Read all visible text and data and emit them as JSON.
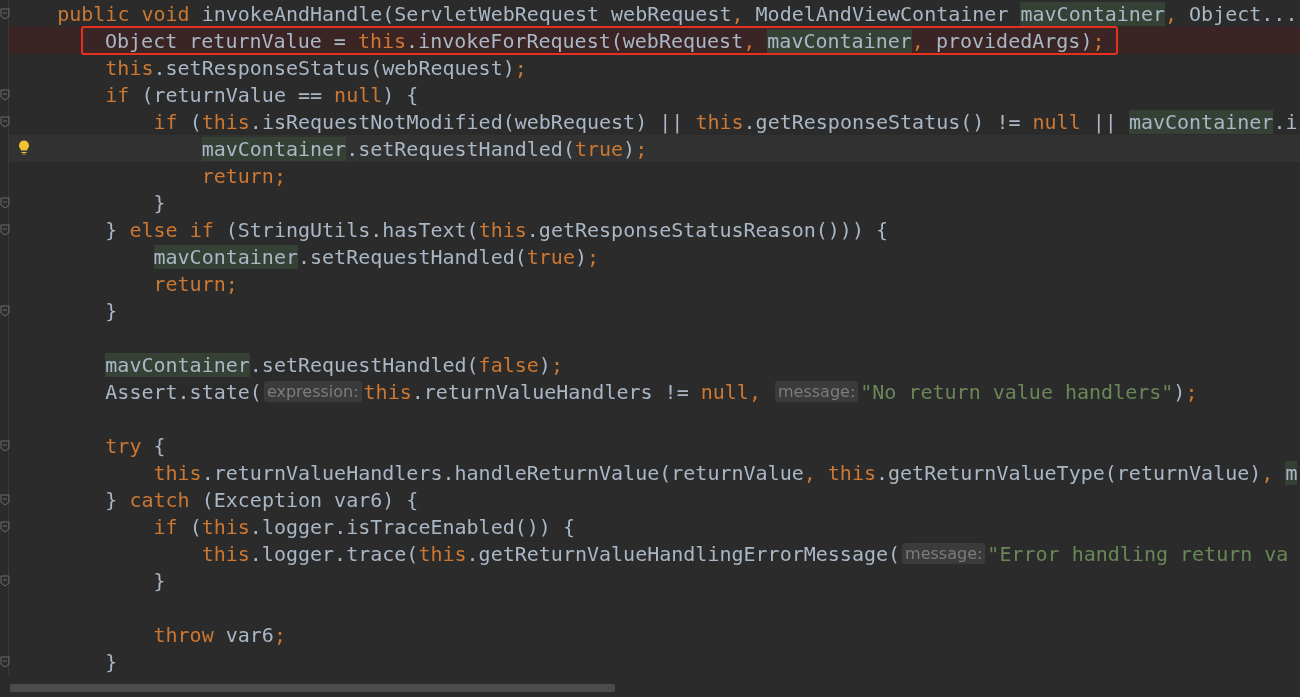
{
  "editor": {
    "lines": [
      {
        "kind": "code",
        "fold": true,
        "tokens": [
          {
            "kind": "keyword",
            "text": "    public void "
          },
          {
            "kind": "plain",
            "text": "invokeAndHandle(ServletWebRequest webRequest"
          },
          {
            "kind": "keyword",
            "text": ", "
          },
          {
            "kind": "plain",
            "text": "ModelAndViewContainer "
          },
          {
            "kind": "usage",
            "text": "mavContainer"
          },
          {
            "kind": "keyword",
            "text": ", "
          },
          {
            "kind": "plain",
            "text": "Object..."
          }
        ]
      },
      {
        "kind": "code",
        "highlighted": true,
        "boxed": true,
        "tokens": [
          {
            "kind": "plain",
            "text": "Object returnValue = "
          },
          {
            "kind": "keyword",
            "text": "this"
          },
          {
            "kind": "plain",
            "text": ".invokeForRequest(webRequest"
          },
          {
            "kind": "keyword",
            "text": ", "
          },
          {
            "kind": "usage",
            "text": "mavContainer"
          },
          {
            "kind": "keyword",
            "text": ", "
          },
          {
            "kind": "plain",
            "text": "providedArgs)"
          },
          {
            "kind": "keyword",
            "text": ";"
          }
        ]
      },
      {
        "kind": "code",
        "tokens": [
          {
            "kind": "keyword",
            "text": "        this"
          },
          {
            "kind": "plain",
            "text": ".setResponseStatus(webRequest)"
          },
          {
            "kind": "keyword",
            "text": ";"
          }
        ]
      },
      {
        "kind": "code",
        "fold": true,
        "tokens": [
          {
            "kind": "keyword",
            "text": "        if "
          },
          {
            "kind": "plain",
            "text": "(returnValue == "
          },
          {
            "kind": "keyword",
            "text": "null"
          },
          {
            "kind": "plain",
            "text": ") {"
          }
        ]
      },
      {
        "kind": "code",
        "fold": true,
        "tokens": [
          {
            "kind": "keyword",
            "text": "            if "
          },
          {
            "kind": "plain",
            "text": "("
          },
          {
            "kind": "keyword",
            "text": "this"
          },
          {
            "kind": "plain",
            "text": ".isRequestNotModified(webRequest) || "
          },
          {
            "kind": "keyword",
            "text": "this"
          },
          {
            "kind": "plain",
            "text": ".getResponseStatus() != "
          },
          {
            "kind": "keyword",
            "text": "null "
          },
          {
            "kind": "plain",
            "text": "|| "
          },
          {
            "kind": "usage",
            "text": "mavContainer"
          },
          {
            "kind": "plain",
            "text": ".i"
          }
        ]
      },
      {
        "kind": "code",
        "current": true,
        "bulb": true,
        "tokens": [
          {
            "kind": "usage",
            "text": "                mavContainer"
          },
          {
            "kind": "plain",
            "text": ".setRequestHandled("
          },
          {
            "kind": "keyword",
            "text": "true"
          },
          {
            "kind": "plain",
            "text": ")"
          },
          {
            "kind": "keyword",
            "text": ";"
          }
        ]
      },
      {
        "kind": "code",
        "tokens": [
          {
            "kind": "keyword",
            "text": "                return;"
          }
        ]
      },
      {
        "kind": "code",
        "fold": true,
        "tokens": [
          {
            "kind": "plain",
            "text": "            }"
          }
        ]
      },
      {
        "kind": "code",
        "fold": true,
        "tokens": [
          {
            "kind": "plain",
            "text": "        } "
          },
          {
            "kind": "keyword",
            "text": "else if "
          },
          {
            "kind": "plain",
            "text": "(StringUtils.hasText("
          },
          {
            "kind": "keyword",
            "text": "this"
          },
          {
            "kind": "plain",
            "text": ".getResponseStatusReason())) {"
          }
        ]
      },
      {
        "kind": "code",
        "tokens": [
          {
            "kind": "usage",
            "text": "            mavContainer"
          },
          {
            "kind": "plain",
            "text": ".setRequestHandled("
          },
          {
            "kind": "keyword",
            "text": "true"
          },
          {
            "kind": "plain",
            "text": ")"
          },
          {
            "kind": "keyword",
            "text": ";"
          }
        ]
      },
      {
        "kind": "code",
        "tokens": [
          {
            "kind": "keyword",
            "text": "            return;"
          }
        ]
      },
      {
        "kind": "code",
        "fold": true,
        "tokens": [
          {
            "kind": "plain",
            "text": "        }"
          }
        ]
      },
      {
        "kind": "blank"
      },
      {
        "kind": "code",
        "tokens": [
          {
            "kind": "usage",
            "text": "        mavContainer"
          },
          {
            "kind": "plain",
            "text": ".setRequestHandled("
          },
          {
            "kind": "keyword",
            "text": "false"
          },
          {
            "kind": "plain",
            "text": ")"
          },
          {
            "kind": "keyword",
            "text": ";"
          }
        ]
      },
      {
        "kind": "code",
        "tokens": [
          {
            "kind": "plain",
            "text": "        Assert.state("
          },
          {
            "kind": "hint",
            "text": "expression:"
          },
          {
            "kind": "keyword",
            "text": "this"
          },
          {
            "kind": "plain",
            "text": ".returnValueHandlers != "
          },
          {
            "kind": "keyword",
            "text": "null, "
          },
          {
            "kind": "hint",
            "text": "message:"
          },
          {
            "kind": "string",
            "text": "\"No return value handlers\""
          },
          {
            "kind": "plain",
            "text": ")"
          },
          {
            "kind": "keyword",
            "text": ";"
          }
        ]
      },
      {
        "kind": "blank"
      },
      {
        "kind": "code",
        "fold": true,
        "tokens": [
          {
            "kind": "keyword",
            "text": "        try "
          },
          {
            "kind": "plain",
            "text": "{"
          }
        ]
      },
      {
        "kind": "code",
        "tokens": [
          {
            "kind": "keyword",
            "text": "            this"
          },
          {
            "kind": "plain",
            "text": ".returnValueHandlers.handleReturnValue(returnValue"
          },
          {
            "kind": "keyword",
            "text": ", this"
          },
          {
            "kind": "plain",
            "text": ".getReturnValueType(returnValue)"
          },
          {
            "kind": "keyword",
            "text": ", "
          },
          {
            "kind": "usage",
            "text": "m"
          }
        ]
      },
      {
        "kind": "code",
        "fold": true,
        "tokens": [
          {
            "kind": "plain",
            "text": "        } "
          },
          {
            "kind": "keyword",
            "text": "catch "
          },
          {
            "kind": "plain",
            "text": "(Exception var6) {"
          }
        ]
      },
      {
        "kind": "code",
        "fold": true,
        "tokens": [
          {
            "kind": "keyword",
            "text": "            if "
          },
          {
            "kind": "plain",
            "text": "("
          },
          {
            "kind": "keyword",
            "text": "this"
          },
          {
            "kind": "plain",
            "text": ".logger.isTraceEnabled()) {"
          }
        ]
      },
      {
        "kind": "code",
        "tokens": [
          {
            "kind": "keyword",
            "text": "                this"
          },
          {
            "kind": "plain",
            "text": ".logger.trace("
          },
          {
            "kind": "keyword",
            "text": "this"
          },
          {
            "kind": "plain",
            "text": ".getReturnValueHandlingErrorMessage("
          },
          {
            "kind": "hint",
            "text": "message:"
          },
          {
            "kind": "string",
            "text": "\"Error handling return va"
          }
        ]
      },
      {
        "kind": "code",
        "fold": true,
        "tokens": [
          {
            "kind": "plain",
            "text": "            }"
          }
        ]
      },
      {
        "kind": "blank"
      },
      {
        "kind": "code",
        "tokens": [
          {
            "kind": "keyword",
            "text": "            throw "
          },
          {
            "kind": "plain",
            "text": "var6"
          },
          {
            "kind": "keyword",
            "text": ";"
          }
        ]
      },
      {
        "kind": "code",
        "fold": true,
        "tokens": [
          {
            "kind": "plain",
            "text": "        }"
          }
        ]
      }
    ]
  }
}
